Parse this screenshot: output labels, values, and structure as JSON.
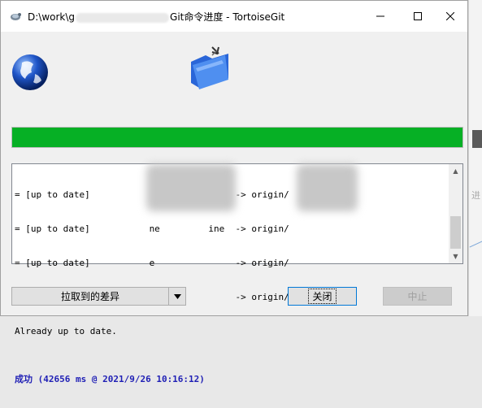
{
  "window": {
    "title_prefix": "D:\\work\\g",
    "title_suffix": "Git命令进度 - TortoiseGit"
  },
  "progress": {
    "fraction": 1.0,
    "color": "#06b025"
  },
  "log": {
    "lines": [
      "= [up to date]                           -> origin/",
      "= [up to date]           ne         ine  -> origin/",
      "= [up to date]           e               -> origin/",
      "= [up to date]           W               -> origin/",
      "Already up to date."
    ],
    "success": "成功 (42656 ms @ 2021/9/26 10:16:12)"
  },
  "buttons": {
    "pull_diff": "拉取到的差异",
    "close": "关闭",
    "abort": "中止"
  },
  "icons": {
    "app": "tortoise-icon",
    "globe": "globe-icon",
    "folder": "folder-sync-icon"
  }
}
